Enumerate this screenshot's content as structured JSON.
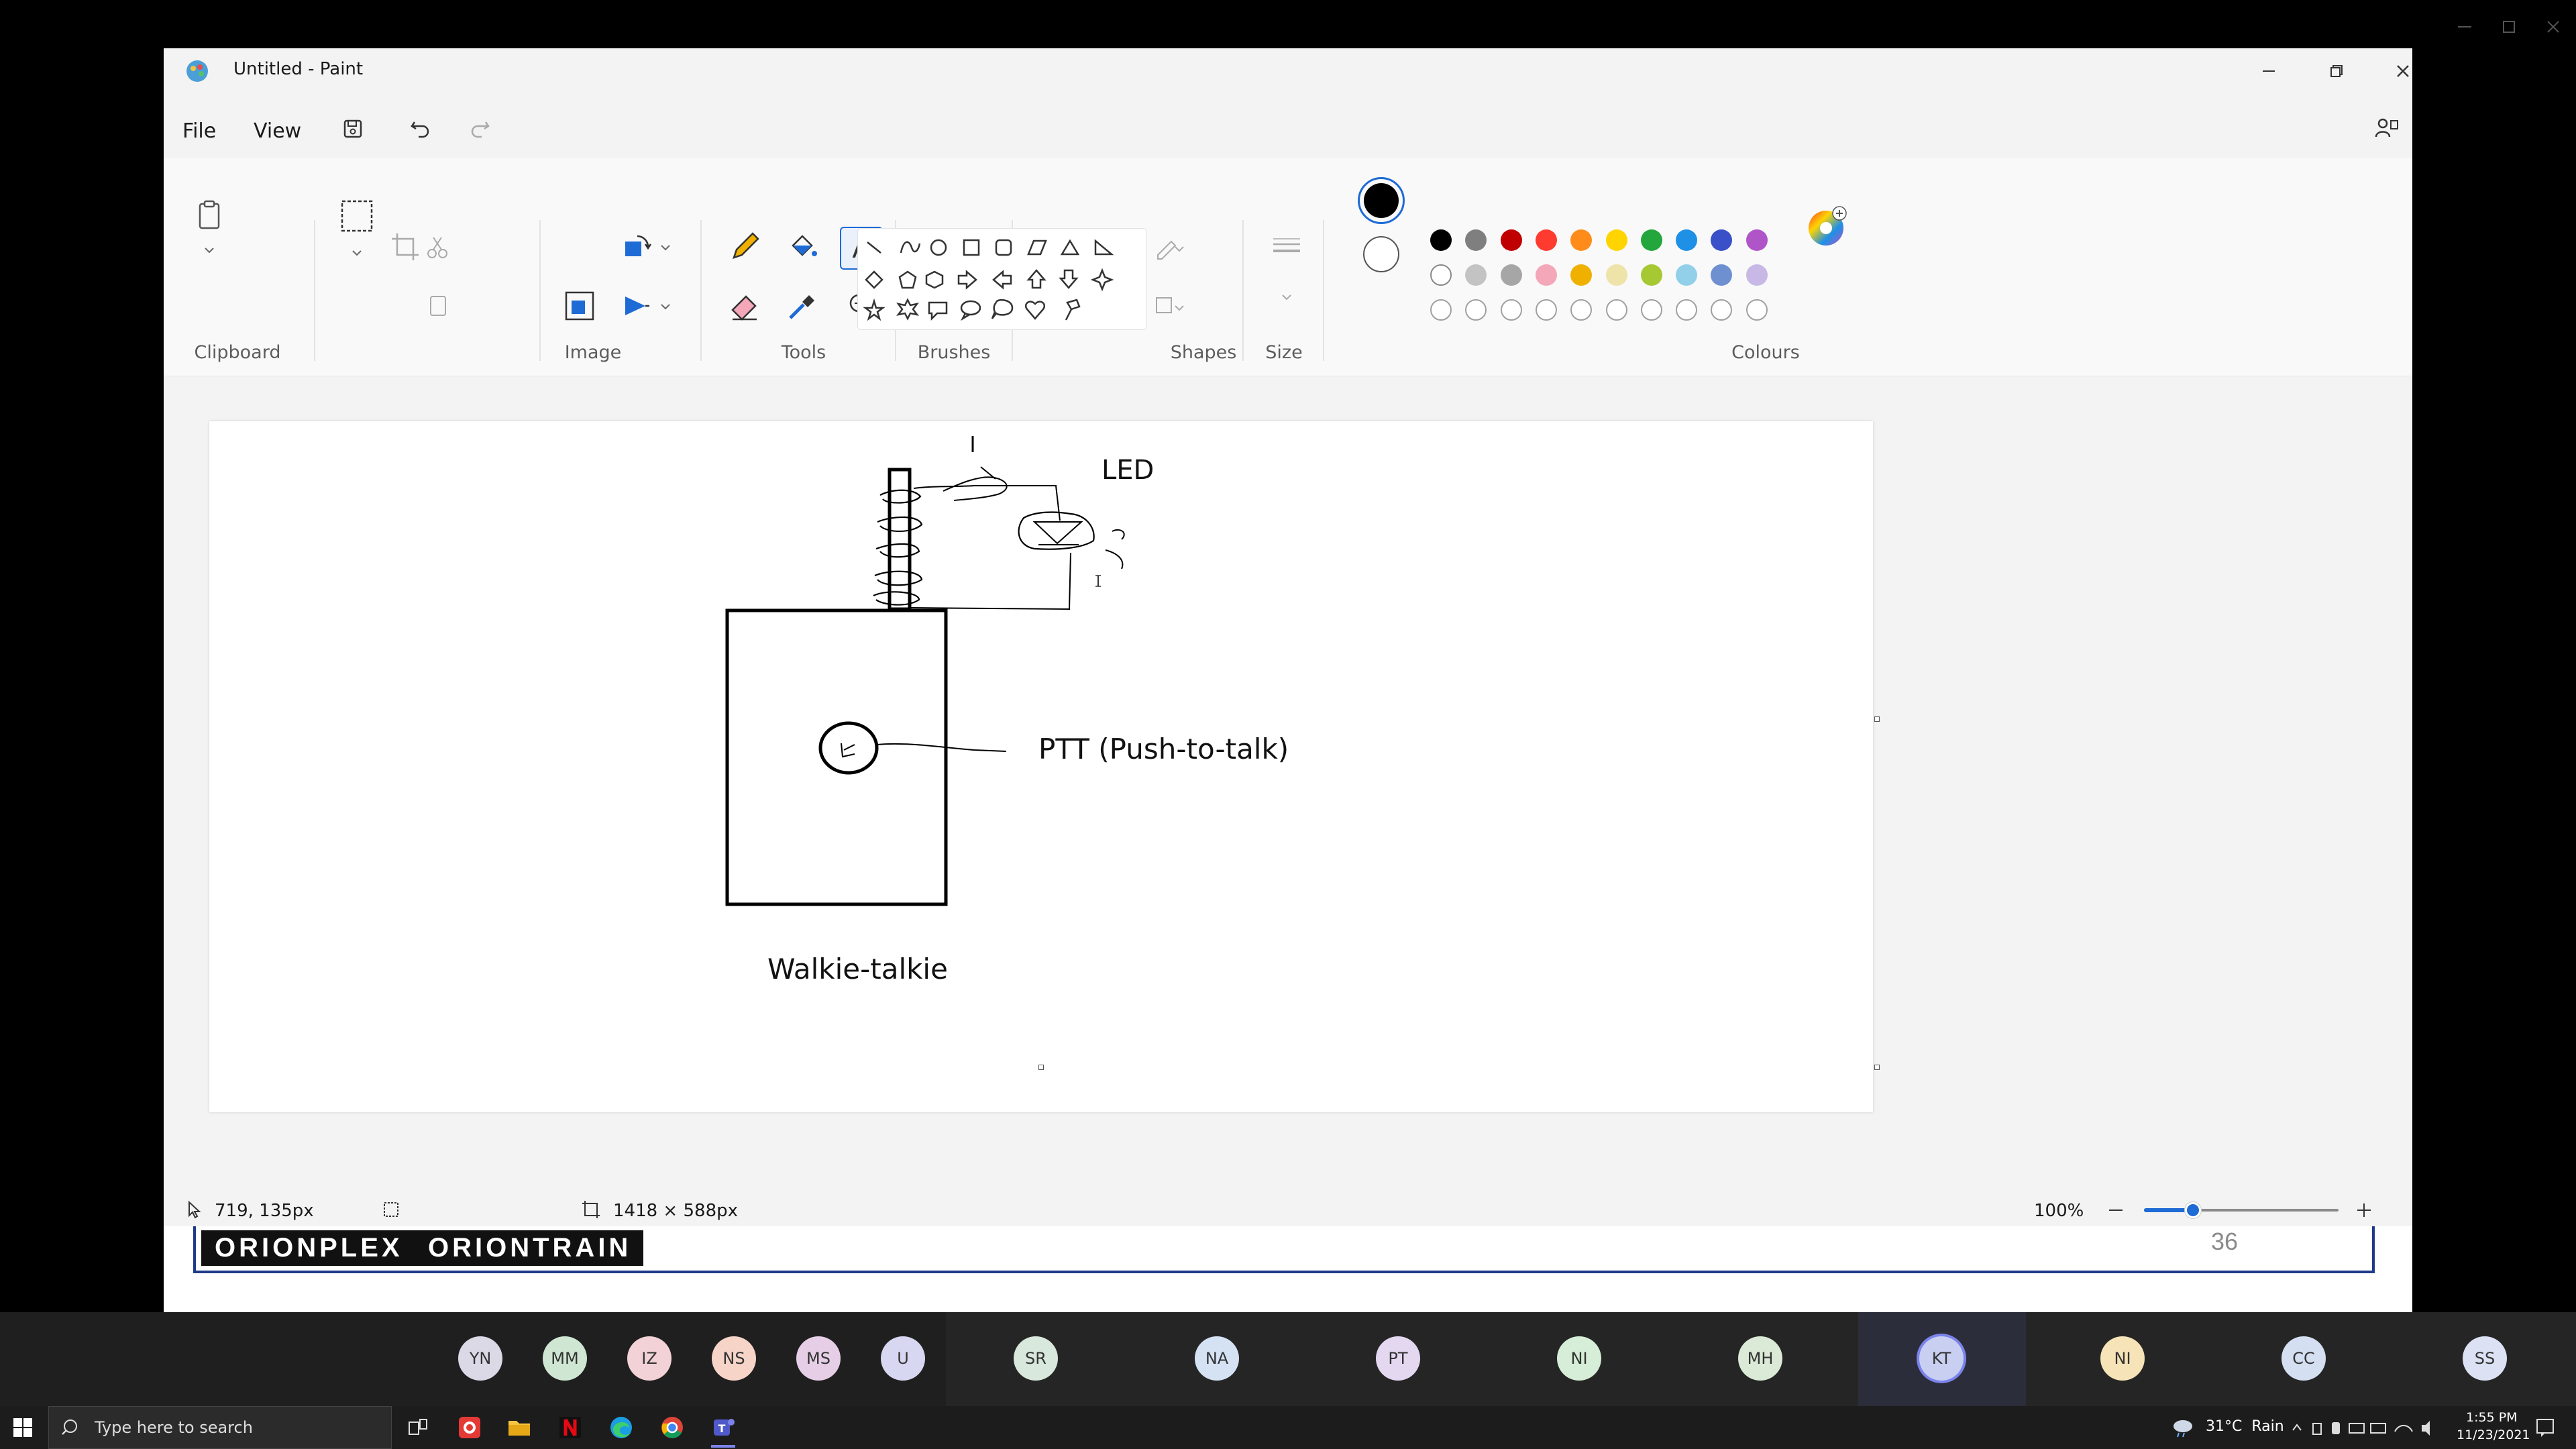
{
  "window": {
    "title": "Untitled - Paint"
  },
  "menu": {
    "file": "File",
    "view": "View"
  },
  "ribbon": {
    "groups": {
      "clipboard": "Clipboard",
      "image": "Image",
      "tools": "Tools",
      "brushes": "Brushes",
      "shapes": "Shapes",
      "size": "Size",
      "colours": "Colours"
    },
    "palette": {
      "row1": [
        "#000000",
        "#7f7f7f",
        "#c00000",
        "#ff3b30",
        "#ff8c1a",
        "#ffd400",
        "#23a63b",
        "#1e90e6",
        "#3a50c8",
        "#b055c8"
      ],
      "row2": [
        "#ffffff",
        "#c3c3c3",
        "#a6a6a6",
        "#f4a7b9",
        "#f0b000",
        "#eee3a8",
        "#a6c832",
        "#92d0ea",
        "#6e8fd0",
        "#c8b8e6"
      ],
      "primary": "#000000",
      "secondary": "#ffffff"
    }
  },
  "drawing": {
    "led_label": "LED",
    "ptt_label": "PTT (Push-to-talk)",
    "device_label": "Walkie-talkie"
  },
  "status": {
    "cursor_pos": "719, 135px",
    "canvas_size": "1418 × 588px",
    "zoom": "100%",
    "zoom_level": 0.25
  },
  "slide_footer": {
    "brand1": "ORIONPLEX",
    "brand2": "ORIONTRAIN",
    "page_number": "36"
  },
  "participants": [
    {
      "initials": "YN",
      "color": "#dcd9e6"
    },
    {
      "initials": "MM",
      "color": "#cfe7d2"
    },
    {
      "initials": "IZ",
      "color": "#f2d2d6"
    },
    {
      "initials": "NS",
      "color": "#f6d4c8"
    },
    {
      "initials": "MS",
      "color": "#e6cfe6"
    },
    {
      "initials": "U",
      "color": "#d7d7f2"
    },
    {
      "initials": "SR",
      "color": "#d8e8dc"
    },
    {
      "initials": "NA",
      "color": "#d4e2f4"
    },
    {
      "initials": "PT",
      "color": "#e4d8f0"
    },
    {
      "initials": "NI",
      "color": "#d6eed8"
    },
    {
      "initials": "MH",
      "color": "#dbead6"
    },
    {
      "initials": "KT",
      "color": "#c9cff0"
    },
    {
      "initials": "NI",
      "color": "#f6e4b8"
    },
    {
      "initials": "CC",
      "color": "#d4e0f2"
    },
    {
      "initials": "SS",
      "color": "#dce2f4"
    }
  ],
  "taskbar": {
    "search_placeholder": "Type here to search",
    "weather": "31°C  Rain",
    "time": "1:55 PM",
    "date": "11/23/2021"
  }
}
